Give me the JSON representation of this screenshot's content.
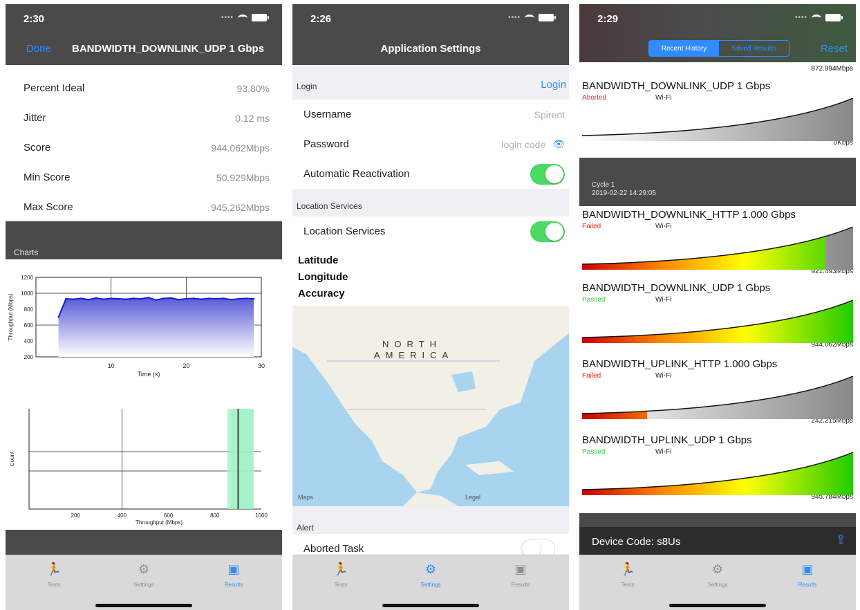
{
  "phone1": {
    "time": "2:30",
    "nav_done": "Done",
    "nav_title": "BANDWIDTH_DOWNLINK_UDP 1 Gbps",
    "stats": [
      {
        "label": "Percent Ideal",
        "value": "93.80%"
      },
      {
        "label": "Jitter",
        "value": "0.12 ms"
      },
      {
        "label": "Score",
        "value": "944.062Mbps"
      },
      {
        "label": "Min Score",
        "value": "50.929Mbps"
      },
      {
        "label": "Max Score",
        "value": "945.262Mbps"
      }
    ],
    "charts_header": "Charts",
    "chart_line_xlabel": "Time (s)",
    "chart_line_ylabel": "Throughput (Mbps)",
    "chart_hist_xlabel": "Throughput (Mbps)",
    "chart_hist_ylabel": "Count"
  },
  "phone2": {
    "time": "2:26",
    "title": "Application Settings",
    "login_header": "Login",
    "login_button": "Login",
    "username_label": "Username",
    "username_value": "Spirent",
    "password_label": "Password",
    "password_value": "login code",
    "auto_react_label": "Automatic Reactivation",
    "location_header": "Location Services",
    "location_label": "Location Services",
    "latitude": "Latitude",
    "longitude": "Longitude",
    "accuracy": "Accuracy",
    "map_label_1": "NORTH",
    "map_label_2": "AMERICA",
    "map_legal": "Legal",
    "map_logo": "Maps",
    "alert_header": "Alert",
    "aborted_task_label": "Aborted Task"
  },
  "phone3": {
    "time": "2:29",
    "seg_recent": "Recent History",
    "seg_saved": "Saved Results",
    "reset": "Reset",
    "top_speed": "872.994Mbps",
    "cycle_label": "Cycle 1",
    "cycle_date": "2019-02-22 14:29:05",
    "device_code_label": "Device Code: s8Us",
    "results": [
      {
        "title": "BANDWIDTH_DOWNLINK_UDP 1 Gbps",
        "status": "Aborted",
        "status_color": "#ff1a1a",
        "network": "Wi-Fi",
        "speed": "0Kbps",
        "fill": 0.0,
        "style": "gray"
      },
      {
        "title": "BANDWIDTH_DOWNLINK_HTTP 1.000 Gbps",
        "status": "Failed",
        "status_color": "#ff1a1a",
        "network": "Wi-Fi",
        "speed": "921.493Mbps",
        "fill": 0.9,
        "style": "color"
      },
      {
        "title": "BANDWIDTH_DOWNLINK_UDP 1 Gbps",
        "status": "Passed",
        "status_color": "#33cc33",
        "network": "Wi-Fi",
        "speed": "944.062Mbps",
        "fill": 1.0,
        "style": "color"
      },
      {
        "title": "BANDWIDTH_UPLINK_HTTP 1.000 Gbps",
        "status": "Failed",
        "status_color": "#ff1a1a",
        "network": "Wi-Fi",
        "speed": "242.215Mbps",
        "fill": 0.24,
        "style": "color"
      },
      {
        "title": "BANDWIDTH_UPLINK_UDP 1 Gbps",
        "status": "Passed",
        "status_color": "#33cc33",
        "network": "Wi-Fi",
        "speed": "945.784Mbps",
        "fill": 1.0,
        "style": "color"
      }
    ]
  },
  "tabs": {
    "tests": "Tests",
    "settings": "Settings",
    "results": "Results"
  },
  "colors": {
    "accent": "#2f8cff",
    "nav_bg": "#4a4a4a",
    "toggle_on": "#4cd964"
  },
  "chart_data": [
    {
      "type": "area",
      "x": [
        3,
        4,
        5,
        6,
        7,
        8,
        9,
        10,
        11,
        12,
        13,
        14,
        15,
        16,
        17,
        18,
        19,
        20,
        21,
        22,
        23,
        24,
        25,
        26,
        27,
        28,
        29
      ],
      "y": [
        700,
        930,
        925,
        935,
        920,
        940,
        925,
        935,
        930,
        925,
        935,
        930,
        945,
        915,
        935,
        940,
        920,
        930,
        935,
        925,
        935,
        930,
        935,
        920,
        930,
        935,
        930
      ],
      "xlabel": "Time (s)",
      "ylabel": "Throughput (Mbps)",
      "xticks": [
        "10",
        "20",
        "30"
      ],
      "yticks": [
        "1200",
        "1000",
        "800",
        "600",
        "400",
        "200"
      ],
      "xlim": [
        0,
        30
      ],
      "ylim": [
        200,
        1200
      ]
    },
    {
      "type": "bar",
      "x": [
        860,
        870,
        875,
        880,
        885,
        890,
        895,
        900,
        905,
        910,
        915,
        920,
        925,
        930,
        935,
        940,
        945,
        950,
        955,
        960,
        965
      ],
      "values": [
        1,
        1,
        1,
        1,
        1,
        1,
        1,
        1,
        1,
        1,
        1,
        1,
        1,
        1,
        1,
        1,
        1,
        1,
        1,
        1,
        1
      ],
      "xlabel": "Throughput (Mbps)",
      "ylabel": "Count",
      "xticks": [
        "200",
        "400",
        "600",
        "800",
        "1000"
      ],
      "xlim": [
        0,
        1000
      ]
    }
  ]
}
